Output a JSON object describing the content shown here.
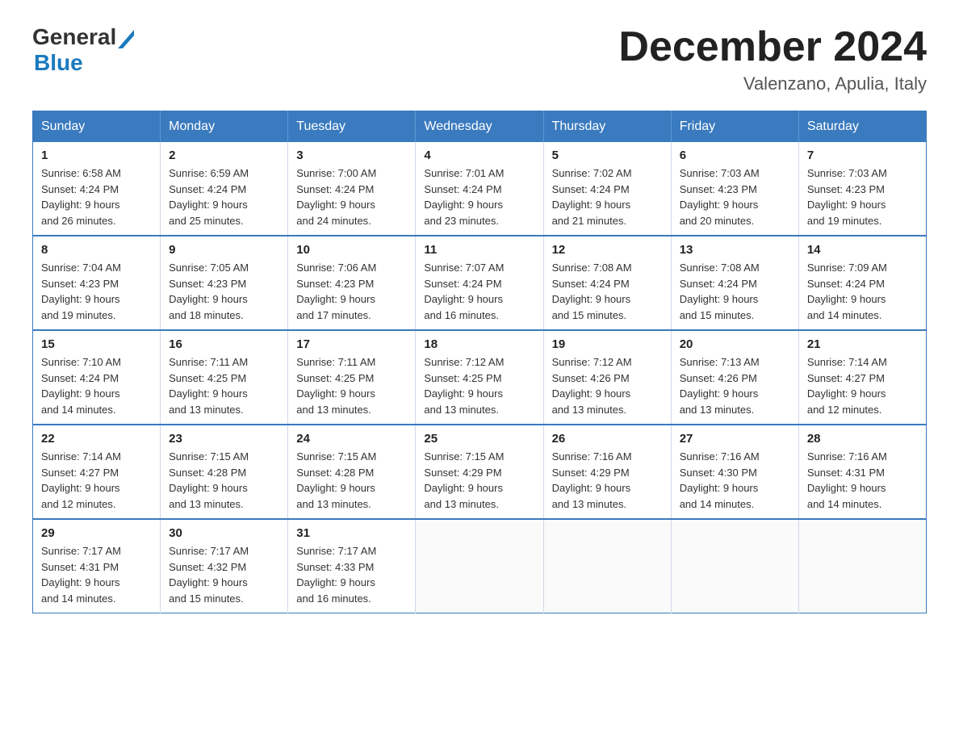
{
  "header": {
    "logo_general": "General",
    "logo_blue": "Blue",
    "month_title": "December 2024",
    "location": "Valenzano, Apulia, Italy"
  },
  "days_of_week": [
    "Sunday",
    "Monday",
    "Tuesday",
    "Wednesday",
    "Thursday",
    "Friday",
    "Saturday"
  ],
  "weeks": [
    [
      {
        "day": "1",
        "sunrise": "Sunrise: 6:58 AM",
        "sunset": "Sunset: 4:24 PM",
        "daylight": "Daylight: 9 hours",
        "daylight2": "and 26 minutes."
      },
      {
        "day": "2",
        "sunrise": "Sunrise: 6:59 AM",
        "sunset": "Sunset: 4:24 PM",
        "daylight": "Daylight: 9 hours",
        "daylight2": "and 25 minutes."
      },
      {
        "day": "3",
        "sunrise": "Sunrise: 7:00 AM",
        "sunset": "Sunset: 4:24 PM",
        "daylight": "Daylight: 9 hours",
        "daylight2": "and 24 minutes."
      },
      {
        "day": "4",
        "sunrise": "Sunrise: 7:01 AM",
        "sunset": "Sunset: 4:24 PM",
        "daylight": "Daylight: 9 hours",
        "daylight2": "and 23 minutes."
      },
      {
        "day": "5",
        "sunrise": "Sunrise: 7:02 AM",
        "sunset": "Sunset: 4:24 PM",
        "daylight": "Daylight: 9 hours",
        "daylight2": "and 21 minutes."
      },
      {
        "day": "6",
        "sunrise": "Sunrise: 7:03 AM",
        "sunset": "Sunset: 4:23 PM",
        "daylight": "Daylight: 9 hours",
        "daylight2": "and 20 minutes."
      },
      {
        "day": "7",
        "sunrise": "Sunrise: 7:03 AM",
        "sunset": "Sunset: 4:23 PM",
        "daylight": "Daylight: 9 hours",
        "daylight2": "and 19 minutes."
      }
    ],
    [
      {
        "day": "8",
        "sunrise": "Sunrise: 7:04 AM",
        "sunset": "Sunset: 4:23 PM",
        "daylight": "Daylight: 9 hours",
        "daylight2": "and 19 minutes."
      },
      {
        "day": "9",
        "sunrise": "Sunrise: 7:05 AM",
        "sunset": "Sunset: 4:23 PM",
        "daylight": "Daylight: 9 hours",
        "daylight2": "and 18 minutes."
      },
      {
        "day": "10",
        "sunrise": "Sunrise: 7:06 AM",
        "sunset": "Sunset: 4:23 PM",
        "daylight": "Daylight: 9 hours",
        "daylight2": "and 17 minutes."
      },
      {
        "day": "11",
        "sunrise": "Sunrise: 7:07 AM",
        "sunset": "Sunset: 4:24 PM",
        "daylight": "Daylight: 9 hours",
        "daylight2": "and 16 minutes."
      },
      {
        "day": "12",
        "sunrise": "Sunrise: 7:08 AM",
        "sunset": "Sunset: 4:24 PM",
        "daylight": "Daylight: 9 hours",
        "daylight2": "and 15 minutes."
      },
      {
        "day": "13",
        "sunrise": "Sunrise: 7:08 AM",
        "sunset": "Sunset: 4:24 PM",
        "daylight": "Daylight: 9 hours",
        "daylight2": "and 15 minutes."
      },
      {
        "day": "14",
        "sunrise": "Sunrise: 7:09 AM",
        "sunset": "Sunset: 4:24 PM",
        "daylight": "Daylight: 9 hours",
        "daylight2": "and 14 minutes."
      }
    ],
    [
      {
        "day": "15",
        "sunrise": "Sunrise: 7:10 AM",
        "sunset": "Sunset: 4:24 PM",
        "daylight": "Daylight: 9 hours",
        "daylight2": "and 14 minutes."
      },
      {
        "day": "16",
        "sunrise": "Sunrise: 7:11 AM",
        "sunset": "Sunset: 4:25 PM",
        "daylight": "Daylight: 9 hours",
        "daylight2": "and 13 minutes."
      },
      {
        "day": "17",
        "sunrise": "Sunrise: 7:11 AM",
        "sunset": "Sunset: 4:25 PM",
        "daylight": "Daylight: 9 hours",
        "daylight2": "and 13 minutes."
      },
      {
        "day": "18",
        "sunrise": "Sunrise: 7:12 AM",
        "sunset": "Sunset: 4:25 PM",
        "daylight": "Daylight: 9 hours",
        "daylight2": "and 13 minutes."
      },
      {
        "day": "19",
        "sunrise": "Sunrise: 7:12 AM",
        "sunset": "Sunset: 4:26 PM",
        "daylight": "Daylight: 9 hours",
        "daylight2": "and 13 minutes."
      },
      {
        "day": "20",
        "sunrise": "Sunrise: 7:13 AM",
        "sunset": "Sunset: 4:26 PM",
        "daylight": "Daylight: 9 hours",
        "daylight2": "and 13 minutes."
      },
      {
        "day": "21",
        "sunrise": "Sunrise: 7:14 AM",
        "sunset": "Sunset: 4:27 PM",
        "daylight": "Daylight: 9 hours",
        "daylight2": "and 12 minutes."
      }
    ],
    [
      {
        "day": "22",
        "sunrise": "Sunrise: 7:14 AM",
        "sunset": "Sunset: 4:27 PM",
        "daylight": "Daylight: 9 hours",
        "daylight2": "and 12 minutes."
      },
      {
        "day": "23",
        "sunrise": "Sunrise: 7:15 AM",
        "sunset": "Sunset: 4:28 PM",
        "daylight": "Daylight: 9 hours",
        "daylight2": "and 13 minutes."
      },
      {
        "day": "24",
        "sunrise": "Sunrise: 7:15 AM",
        "sunset": "Sunset: 4:28 PM",
        "daylight": "Daylight: 9 hours",
        "daylight2": "and 13 minutes."
      },
      {
        "day": "25",
        "sunrise": "Sunrise: 7:15 AM",
        "sunset": "Sunset: 4:29 PM",
        "daylight": "Daylight: 9 hours",
        "daylight2": "and 13 minutes."
      },
      {
        "day": "26",
        "sunrise": "Sunrise: 7:16 AM",
        "sunset": "Sunset: 4:29 PM",
        "daylight": "Daylight: 9 hours",
        "daylight2": "and 13 minutes."
      },
      {
        "day": "27",
        "sunrise": "Sunrise: 7:16 AM",
        "sunset": "Sunset: 4:30 PM",
        "daylight": "Daylight: 9 hours",
        "daylight2": "and 14 minutes."
      },
      {
        "day": "28",
        "sunrise": "Sunrise: 7:16 AM",
        "sunset": "Sunset: 4:31 PM",
        "daylight": "Daylight: 9 hours",
        "daylight2": "and 14 minutes."
      }
    ],
    [
      {
        "day": "29",
        "sunrise": "Sunrise: 7:17 AM",
        "sunset": "Sunset: 4:31 PM",
        "daylight": "Daylight: 9 hours",
        "daylight2": "and 14 minutes."
      },
      {
        "day": "30",
        "sunrise": "Sunrise: 7:17 AM",
        "sunset": "Sunset: 4:32 PM",
        "daylight": "Daylight: 9 hours",
        "daylight2": "and 15 minutes."
      },
      {
        "day": "31",
        "sunrise": "Sunrise: 7:17 AM",
        "sunset": "Sunset: 4:33 PM",
        "daylight": "Daylight: 9 hours",
        "daylight2": "and 16 minutes."
      },
      null,
      null,
      null,
      null
    ]
  ]
}
